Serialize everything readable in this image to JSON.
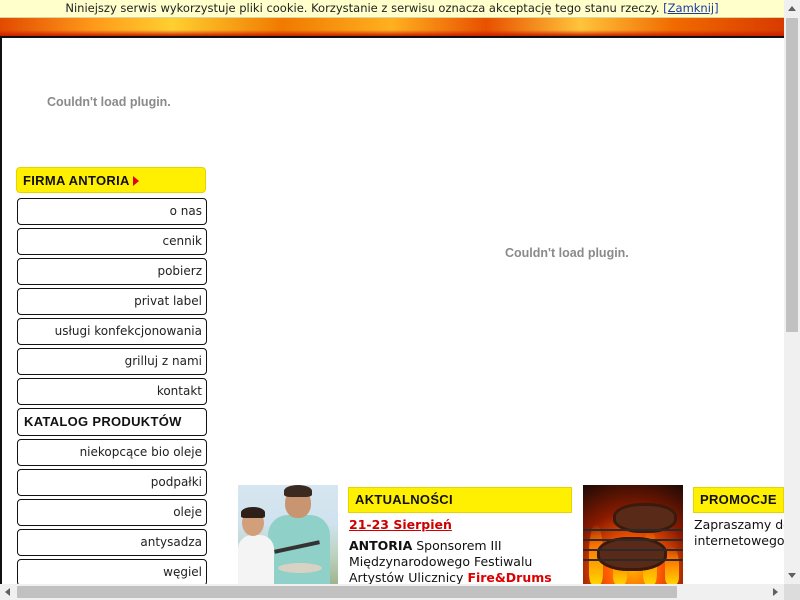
{
  "cookie_notice": {
    "text": "Niniejszy serwis wykorzystuje pliki cookie. Korzystanie z serwisu oznacza akceptację tego stanu rzeczy.",
    "close_link": "[Zamknij]"
  },
  "plugins": {
    "left_message": "Couldn't load plugin.",
    "center_message": "Couldn't load plugin."
  },
  "sidebar": {
    "firma_header": "FIRMA ANTORIA",
    "firma_items": [
      {
        "label": "o nas"
      },
      {
        "label": "cennik"
      },
      {
        "label": "pobierz"
      },
      {
        "label": "privat label"
      },
      {
        "label": "usługi konfekcjonowania"
      },
      {
        "label": "grilluj z nami"
      },
      {
        "label": "kontakt"
      }
    ],
    "katalog_header": "KATALOG PRODUKTÓW",
    "katalog_items": [
      {
        "label": "niekopcące bio oleje"
      },
      {
        "label": "podpałki"
      },
      {
        "label": "oleje"
      },
      {
        "label": "antysadza"
      },
      {
        "label": "węgiel"
      }
    ]
  },
  "news": {
    "header": "AKTUALNOŚCI",
    "date": "21-23 Sierpień",
    "brand": "ANTORIA",
    "text": "Sponsorem III Międzynarodowego Festiwalu Artystów Ulicznicy",
    "highlight": "Fire&Drums"
  },
  "promo": {
    "header": "PROMOCJE",
    "line1": "Zapraszamy do",
    "line2": "internetowego"
  },
  "colors": {
    "accent_yellow": "#ffef00",
    "link_red": "#cc0000",
    "fire_orange": "#f07a00"
  }
}
